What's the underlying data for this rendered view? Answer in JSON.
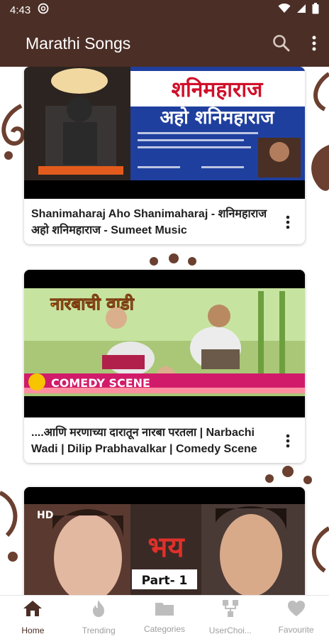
{
  "status": {
    "time": "4:43"
  },
  "app_bar": {
    "title": "Marathi Songs"
  },
  "videos": [
    {
      "title": "Shanimaharaj Aho Shanimaharaj - शनिमहाराज अहो शनिमहाराज - Sumeet Music",
      "thumb_title_line1": "शनिमहाराज",
      "thumb_title_line2": "अहो शनिमहाराज"
    },
    {
      "title": "....आणि मरणाच्या दारातून नारबा परतला | Narbachi Wadi | Dilip Prabhavalkar | Comedy Scene",
      "thumb_title": "नारबाची वाडी",
      "thumb_badge": "COMEDY SCENE"
    },
    {
      "title": "",
      "thumb_badge": "HD",
      "thumb_title": "भय",
      "thumb_part": "Part- 1"
    }
  ],
  "bottom_nav": [
    {
      "label": "Home"
    },
    {
      "label": "Trending"
    },
    {
      "label": "Categories"
    },
    {
      "label": "UserChoi..."
    },
    {
      "label": "Favourite"
    }
  ],
  "colors": {
    "primary": "#4b2e25",
    "inactive": "#9e9e9e"
  }
}
